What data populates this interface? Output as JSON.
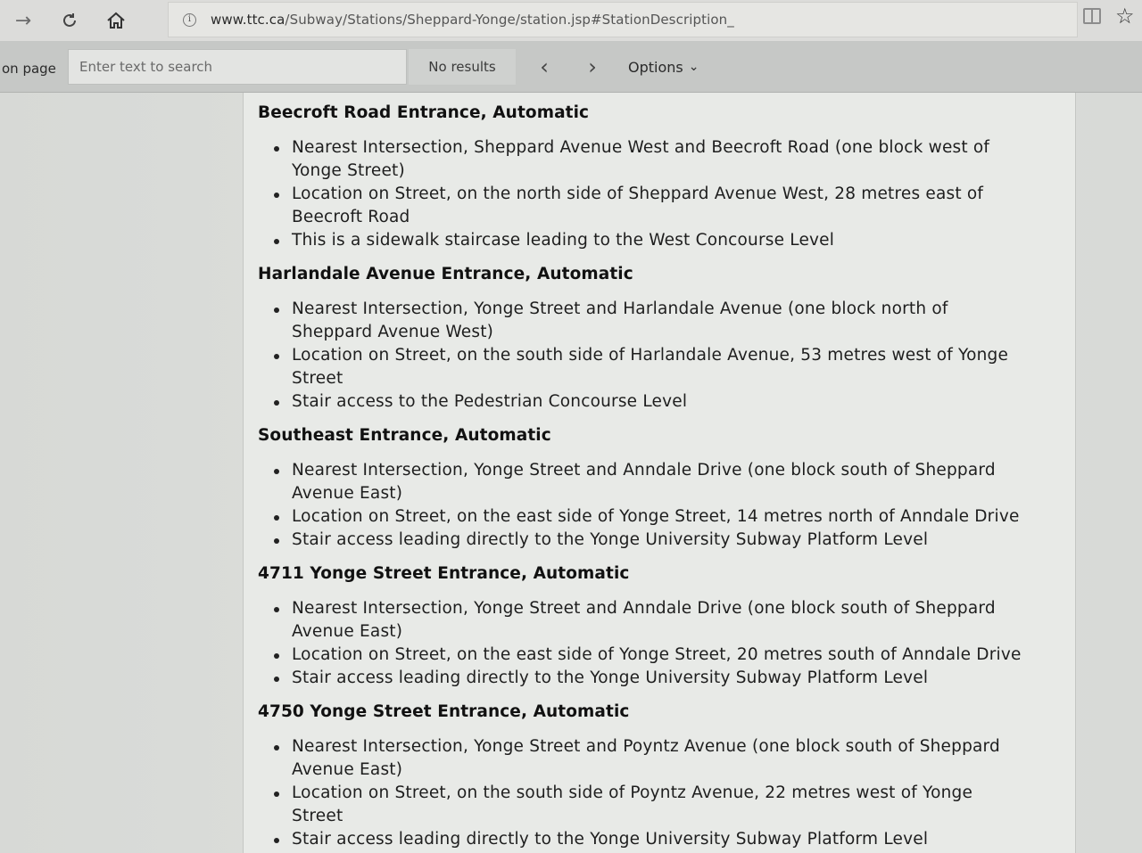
{
  "browser": {
    "url_host": "www.ttc.ca",
    "url_path": "/Subway/Stations/Sheppard-Yonge/station.jsp#StationDescription_",
    "icons": [
      "back-arrow-icon",
      "refresh-icon",
      "home-icon",
      "info-icon",
      "reading-view-icon",
      "favorite-star-icon"
    ]
  },
  "find_bar": {
    "label": "on page",
    "placeholder": "Enter text to search",
    "status": "No results",
    "prev": "‹",
    "next": "›",
    "options_label": "Options"
  },
  "entrances": [
    {
      "title": "Beecroft Road Entrance, Automatic",
      "items": [
        "Nearest Intersection, Sheppard Avenue West and Beecroft Road (one block west of Yonge Street)",
        "Location on Street, on the north side of Sheppard Avenue West, 28 metres east of Beecroft Road",
        "This is a sidewalk staircase leading to the West Concourse Level"
      ]
    },
    {
      "title": "Harlandale Avenue Entrance, Automatic",
      "items": [
        "Nearest Intersection, Yonge Street and Harlandale Avenue (one block north of Sheppard Avenue West)",
        "Location on Street, on the south side of Harlandale Avenue, 53 metres west of Yonge Street",
        "Stair access to the Pedestrian Concourse Level"
      ]
    },
    {
      "title": "Southeast Entrance, Automatic",
      "items": [
        "Nearest Intersection, Yonge Street and Anndale Drive (one block south of Sheppard Avenue East)",
        "Location on Street, on the east side of Yonge Street, 14 metres north of Anndale Drive",
        "Stair access leading directly to the Yonge University Subway Platform Level"
      ]
    },
    {
      "title": "4711 Yonge Street Entrance, Automatic",
      "items": [
        "Nearest Intersection, Yonge Street and Anndale Drive (one block south of Sheppard Avenue East)",
        "Location on Street, on the east side of Yonge Street, 20 metres south of Anndale Drive",
        "Stair access leading directly to the Yonge University Subway Platform Level"
      ]
    },
    {
      "title": "4750 Yonge Street Entrance, Automatic",
      "items": [
        "Nearest Intersection, Yonge Street and Poyntz Avenue (one block south of Sheppard Avenue East)",
        "Location on Street, on the south side of Poyntz Avenue, 22 metres west of Yonge Street",
        "Stair access leading directly to the Yonge University Subway Platform Level"
      ]
    }
  ]
}
